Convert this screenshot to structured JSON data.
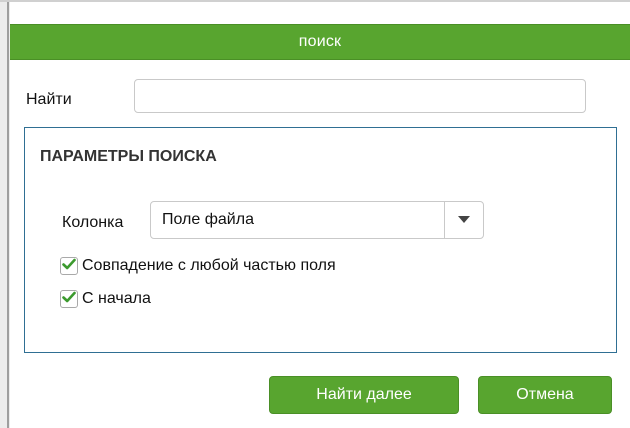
{
  "dialog": {
    "title": "поиск",
    "find_label": "Найти",
    "find_input": {
      "value": "",
      "placeholder": ""
    }
  },
  "search_params": {
    "title": "ПАРАМЕТРЫ ПОИСКА",
    "column_label": "Колонка",
    "column_select": {
      "value": "Поле файла"
    },
    "options": [
      {
        "label": "Совпадение с любой частью поля",
        "checked": true
      },
      {
        "label": "С начала",
        "checked": true
      }
    ]
  },
  "buttons": {
    "find_next": "Найти далее",
    "cancel": "Отмена"
  },
  "colors": {
    "accent": "#58a52f",
    "box_border": "#2f6f93",
    "check_mark": "#3c9a2e"
  },
  "icons": {
    "dropdown": "chevron-down-icon",
    "checkbox_checked": "check-icon"
  }
}
